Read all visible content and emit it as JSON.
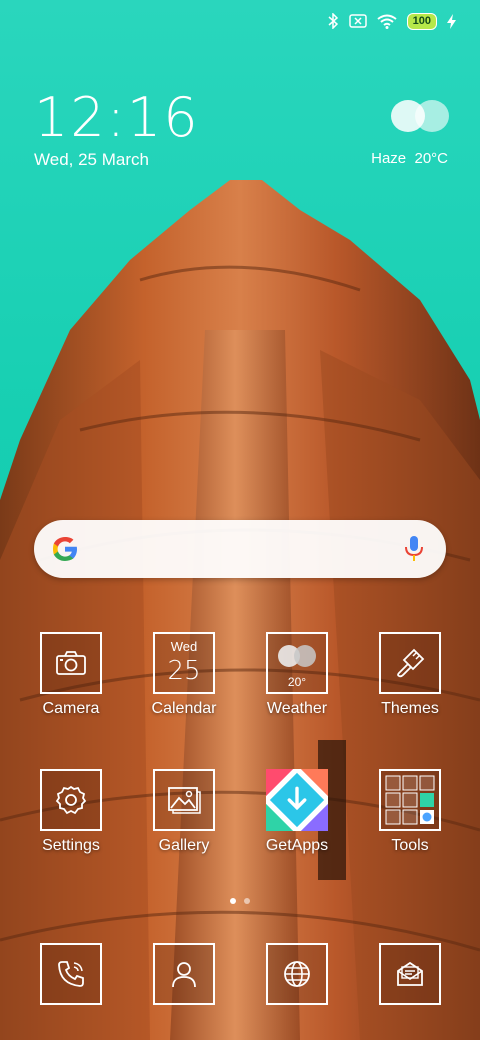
{
  "status_bar": {
    "icons": [
      "bluetooth-icon",
      "no-sim-icon",
      "wifi-icon",
      "charging-icon"
    ],
    "battery": "100"
  },
  "clock": {
    "time": "12:16",
    "date": "Wed, 25 March"
  },
  "weather_widget": {
    "condition": "Haze",
    "temperature": "20°C",
    "text": "Haze  20°C"
  },
  "search_bar": {
    "icons": [
      "google-g-icon",
      "microphone-icon"
    ]
  },
  "apps": [
    {
      "label": "Camera",
      "icon": "camera-icon"
    },
    {
      "label": "Calendar",
      "icon": "calendar-icon",
      "day": "Wed",
      "date": "25"
    },
    {
      "label": "Weather",
      "icon": "cloud-icon",
      "temp": "20°"
    },
    {
      "label": "Themes",
      "icon": "paintbrush-icon"
    },
    {
      "label": "Settings",
      "icon": "gear-icon"
    },
    {
      "label": "Gallery",
      "icon": "image-icon"
    },
    {
      "label": "GetApps",
      "icon": "getapps-icon"
    },
    {
      "label": "Tools",
      "icon": "tools-folder-icon"
    }
  ],
  "page_indicator": {
    "pages": 2,
    "current": 1
  },
  "dock": [
    {
      "icon": "phone-icon"
    },
    {
      "icon": "contacts-icon"
    },
    {
      "icon": "browser-globe-icon"
    },
    {
      "icon": "messages-icon"
    }
  ]
}
